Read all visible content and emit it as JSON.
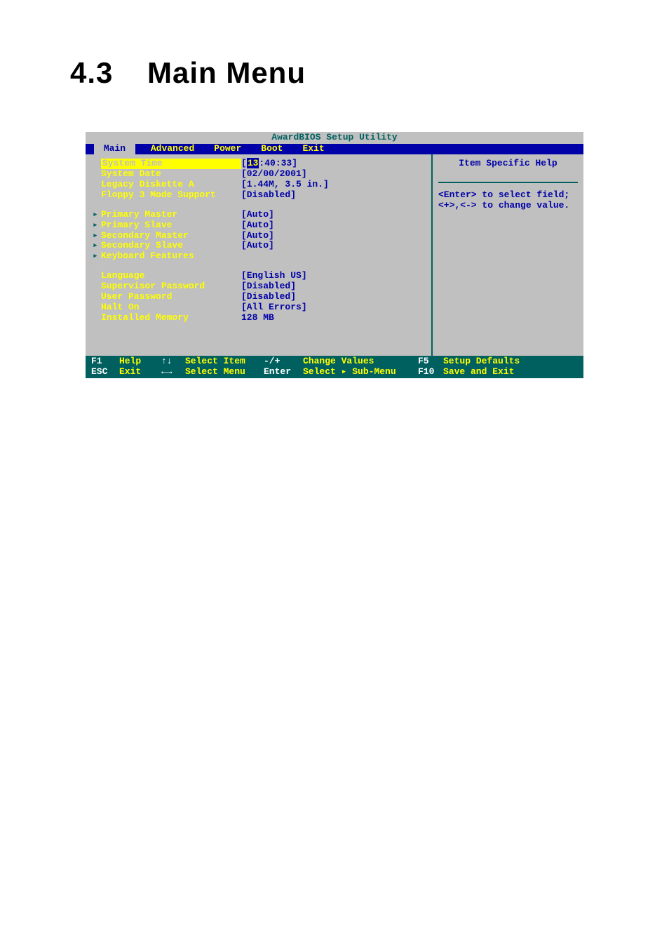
{
  "heading": {
    "num": "4.3",
    "title": "Main Menu"
  },
  "bios": {
    "title": "AwardBIOS Setup Utility",
    "tabs": [
      "Main",
      "Advanced",
      "Power",
      "Boot",
      "Exit"
    ],
    "active_tab": 0,
    "fields": {
      "system_time": {
        "label": "System Time",
        "value_prefix": "[",
        "value_sel": "13",
        "value_suffix": ":40:33]",
        "selected": true,
        "submenu": false
      },
      "system_date": {
        "label": "System Date",
        "value": "[02/00/2001]",
        "submenu": false
      },
      "legacy_diskette_a": {
        "label": "Legacy Diskette A",
        "value": "[1.44M, 3.5 in.]",
        "submenu": false
      },
      "floppy3": {
        "label": "Floppy 3 Mode Support",
        "value": "[Disabled]",
        "submenu": false
      },
      "primary_master": {
        "label": "Primary Master",
        "value": "[Auto]",
        "submenu": true
      },
      "primary_slave": {
        "label": "Primary Slave",
        "value": "[Auto]",
        "submenu": true
      },
      "secondary_master": {
        "label": "Secondary Master",
        "value": "[Auto]",
        "submenu": true
      },
      "secondary_slave": {
        "label": "Secondary Slave",
        "value": "[Auto]",
        "submenu": true
      },
      "keyboard_features": {
        "label": "Keyboard Features",
        "value": "",
        "submenu": true
      },
      "language": {
        "label": "Language",
        "value": "[English US]",
        "submenu": false
      },
      "supervisor_password": {
        "label": "Supervisor Password",
        "value": "[Disabled]",
        "submenu": false
      },
      "user_password": {
        "label": "User Password",
        "value": "[Disabled]",
        "submenu": false
      },
      "halt_on": {
        "label": "Halt On",
        "value": "[All Errors]",
        "submenu": false
      },
      "installed_memory": {
        "label": "Installed Memory",
        "value": "128 MB",
        "submenu": false
      }
    },
    "help": {
      "title": "Item Specific Help",
      "text": "<Enter> to select field;\n<+>,<-> to change value."
    },
    "footer": {
      "r1": {
        "k1": "F1",
        "d1": "Help",
        "k2": "↑↓",
        "d2": "Select Item",
        "k3": "-/+",
        "d3": "Change Values",
        "k4": "F5",
        "d4": "Setup Defaults"
      },
      "r2": {
        "k1": "ESC",
        "d1": "Exit",
        "k2": "←→",
        "d2": "Select Menu",
        "k3": "Enter",
        "d3": "Select ▸ Sub-Menu",
        "k4": "F10",
        "d4": "Save and Exit"
      }
    }
  }
}
